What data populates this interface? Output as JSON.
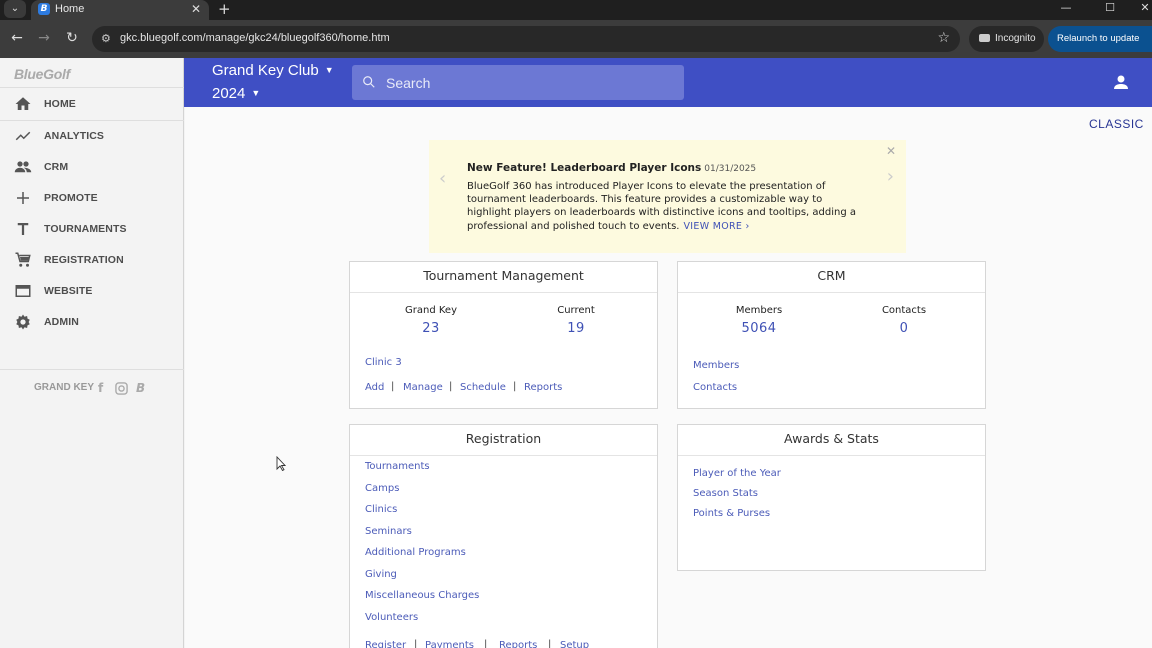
{
  "browser": {
    "tab_title": "Home",
    "url": "gkc.bluegolf.com/manage/gkc24/bluegolf360/home.htm",
    "incognito_label": "Incognito",
    "relaunch_label": "Relaunch to update"
  },
  "sidebar": {
    "logo": "BlueGolf",
    "items": [
      {
        "label": "HOME",
        "icon": "home-icon"
      },
      {
        "label": "ANALYTICS",
        "icon": "trend-icon"
      },
      {
        "label": "CRM",
        "icon": "people-icon"
      },
      {
        "label": "PROMOTE",
        "icon": "plus-icon"
      },
      {
        "label": "TOURNAMENTS",
        "icon": "tournament-t-icon"
      },
      {
        "label": "REGISTRATION",
        "icon": "cart-icon"
      },
      {
        "label": "WEBSITE",
        "icon": "browser-window-icon"
      },
      {
        "label": "ADMIN",
        "icon": "gear-icon"
      }
    ],
    "footer_label": "GRAND KEY",
    "social_icons": [
      "facebook-icon",
      "instagram-icon",
      "bluegolf-icon"
    ]
  },
  "appbar": {
    "club": "Grand Key Club",
    "year": "2024",
    "search_placeholder": "Search",
    "color": "#3f4fc4"
  },
  "main": {
    "classic_link": "CLASSIC",
    "announcement": {
      "title": "New Feature! Leaderboard Player Icons",
      "date": "01/31/2025",
      "body": "BlueGolf 360 has introduced Player Icons to elevate the presentation of tournament leaderboards. This feature provides a customizable way to highlight players on leaderboards with distinctive icons and tooltips, adding a professional and polished touch to events.",
      "more": "VIEW MORE ›"
    },
    "tournament_mgmt": {
      "title": "Tournament Management",
      "stats": [
        {
          "label": "Grand Key",
          "value": "23"
        },
        {
          "label": "Current",
          "value": "19"
        }
      ],
      "featured": "Clinic 3",
      "actions": [
        "Add",
        "Manage",
        "Schedule",
        "Reports"
      ]
    },
    "crm": {
      "title": "CRM",
      "stats": [
        {
          "label": "Members",
          "value": "5064"
        },
        {
          "label": "Contacts",
          "value": "0"
        }
      ],
      "links": [
        "Members",
        "Contacts"
      ]
    },
    "registration": {
      "title": "Registration",
      "links": [
        "Tournaments",
        "Camps",
        "Clinics",
        "Seminars",
        "Additional Programs",
        "Giving",
        "Miscellaneous Charges",
        "Volunteers"
      ],
      "actions": [
        "Register",
        "Payments",
        "Reports",
        "Setup"
      ]
    },
    "awards": {
      "title": "Awards & Stats",
      "links": [
        "Player of the Year",
        "Season Stats",
        "Points & Purses"
      ]
    }
  }
}
